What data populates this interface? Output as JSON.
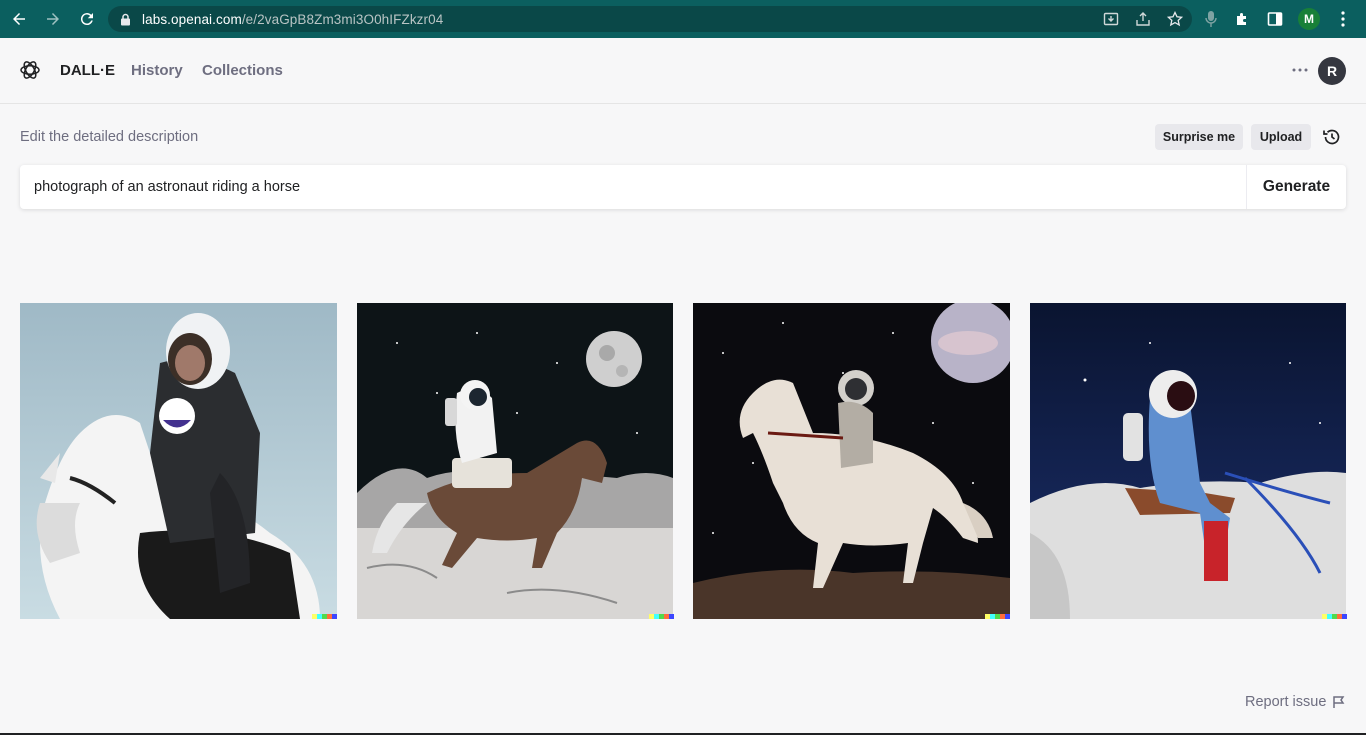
{
  "browser": {
    "url_host": "labs.openai.com",
    "url_path": "/e/2vaGpB8Zm3mi3O0hIFZkzr04",
    "profile_initial": "M"
  },
  "header": {
    "brand": "DALL·E",
    "nav": [
      "History",
      "Collections"
    ],
    "avatar_initial": "R"
  },
  "editor": {
    "label": "Edit the detailed description",
    "surprise_label": "Surprise me",
    "upload_label": "Upload",
    "prompt_value": "photograph of an astronaut riding a horse",
    "generate_label": "Generate"
  },
  "images": [
    {
      "name": "result-image-1"
    },
    {
      "name": "result-image-2"
    },
    {
      "name": "result-image-3"
    },
    {
      "name": "result-image-4"
    }
  ],
  "footer": {
    "report_label": "Report issue"
  },
  "colors": {
    "browser_bar": "#0b5f5f",
    "signature": [
      "#ffff66",
      "#42ffff",
      "#51da4c",
      "#ff6e3c",
      "#3c46ff"
    ]
  }
}
